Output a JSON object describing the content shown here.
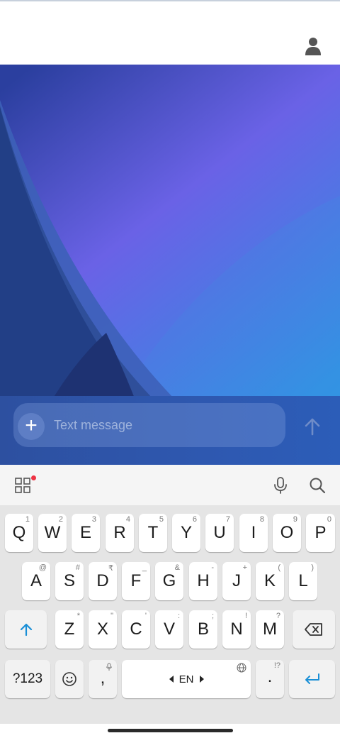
{
  "header": {
    "profile_icon": "person-icon"
  },
  "composer": {
    "placeholder": "Text message",
    "attach_icon": "plus-icon",
    "attach_glyph": "+",
    "send_icon": "arrow-up-icon"
  },
  "keyboard_toolbar": {
    "apps_icon": "grid-icon",
    "voice_icon": "mic-icon",
    "search_icon": "search-icon",
    "notification_dot_color": "#ee3344"
  },
  "keyboard": {
    "row1": [
      {
        "label": "Q",
        "hint": "1"
      },
      {
        "label": "W",
        "hint": "2"
      },
      {
        "label": "E",
        "hint": "3"
      },
      {
        "label": "R",
        "hint": "4"
      },
      {
        "label": "T",
        "hint": "5"
      },
      {
        "label": "Y",
        "hint": "6"
      },
      {
        "label": "U",
        "hint": "7"
      },
      {
        "label": "I",
        "hint": "8"
      },
      {
        "label": "O",
        "hint": "9"
      },
      {
        "label": "P",
        "hint": "0"
      }
    ],
    "row2": [
      {
        "label": "A",
        "hint": "@"
      },
      {
        "label": "S",
        "hint": "#"
      },
      {
        "label": "D",
        "hint": "₹"
      },
      {
        "label": "F",
        "hint": "_"
      },
      {
        "label": "G",
        "hint": "&"
      },
      {
        "label": "H",
        "hint": "-"
      },
      {
        "label": "J",
        "hint": "+"
      },
      {
        "label": "K",
        "hint": "("
      },
      {
        "label": "L",
        "hint": ")"
      }
    ],
    "row3": [
      {
        "label": "Z",
        "hint": "*"
      },
      {
        "label": "X",
        "hint": "\""
      },
      {
        "label": "C",
        "hint": "'"
      },
      {
        "label": "V",
        "hint": ":"
      },
      {
        "label": "B",
        "hint": ";"
      },
      {
        "label": "N",
        "hint": "!"
      },
      {
        "label": "M",
        "hint": "?"
      }
    ],
    "shift_icon": "shift-arrow-icon",
    "backspace_icon": "backspace-icon",
    "symbols_label": "?123",
    "emoji_icon": "smiley-icon",
    "comma_label": ",",
    "space_label": "EN",
    "space_globe_icon": "globe-icon",
    "period_label": ".",
    "period_hint": "!?",
    "enter_icon": "enter-arrow-icon",
    "accent_color": "#1a8fd6"
  },
  "colors": {
    "wallpaper_top": "#2d46a6",
    "wallpaper_mid": "#6a62e6",
    "wallpaper_bottom": "#2e8be0",
    "composer_bg": "#2e56ad"
  }
}
